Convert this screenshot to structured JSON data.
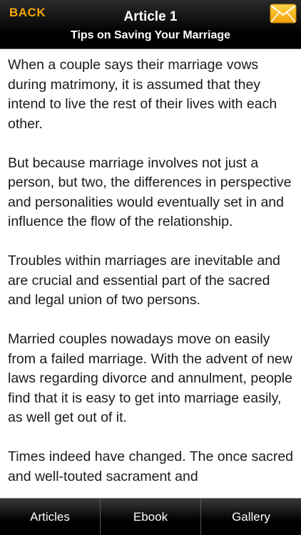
{
  "header": {
    "back_label": "BACK",
    "title": "Article 1",
    "subtitle": "Tips on Saving Your Marriage",
    "mail_icon": "envelope-icon",
    "accent_color": "#f5a800"
  },
  "article": {
    "paragraphs": [
      "When a couple says their marriage vows during matrimony, it is assumed that they intend to live the rest of their lives with each other.",
      "But because marriage involves not just a person, but two, the differences in perspective and personalities would eventually set in and influence the flow of the relationship.",
      "Troubles within marriages are inevitable and are crucial and essential part of the sacred and legal union of two persons.",
      "Married couples nowadays move on easily from a failed marriage. With the advent of new laws regarding divorce and annulment, people find that it is easy to get into marriage easily, as well get out of it.",
      "Times indeed have changed. The once sacred and well-touted sacrament and"
    ]
  },
  "tabbar": {
    "tabs": [
      {
        "label": "Articles"
      },
      {
        "label": "Ebook"
      },
      {
        "label": "Gallery"
      }
    ]
  }
}
